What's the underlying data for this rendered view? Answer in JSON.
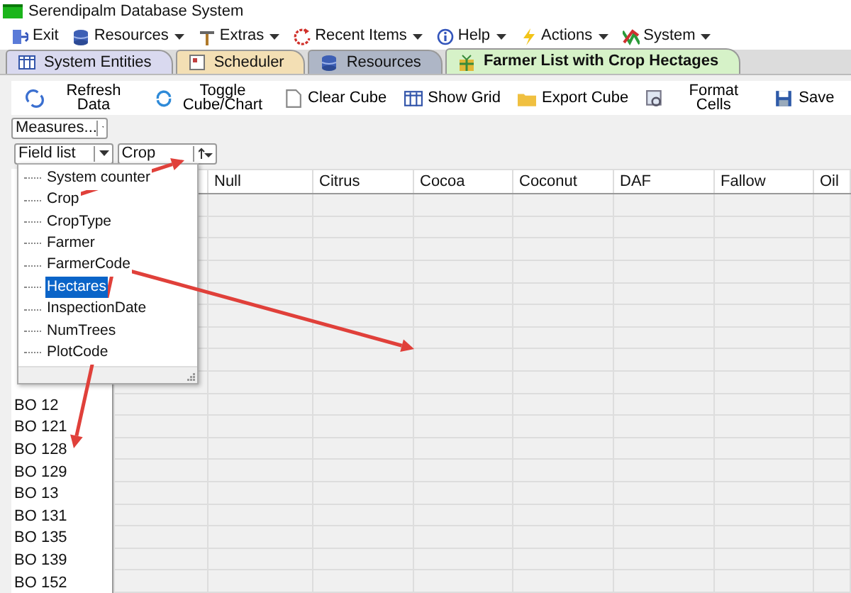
{
  "window": {
    "title": "Serendipalm Database System"
  },
  "menu": [
    {
      "label": "Exit",
      "dropdown": false
    },
    {
      "label": "Resources",
      "dropdown": true
    },
    {
      "label": "Extras",
      "dropdown": true
    },
    {
      "label": "Recent Items",
      "dropdown": true
    },
    {
      "label": "Help",
      "dropdown": true
    },
    {
      "label": "Actions",
      "dropdown": true
    },
    {
      "label": "System",
      "dropdown": true
    }
  ],
  "tabs": [
    {
      "label": "System Entities",
      "color": "#d9d9ef",
      "selected": false
    },
    {
      "label": "Scheduler",
      "color": "#f3dfb4",
      "selected": false
    },
    {
      "label": "Resources",
      "color": "#aeb6c6",
      "selected": false
    },
    {
      "label": "Farmer List with Crop Hectages",
      "color": "#d6f2c8",
      "selected": true
    }
  ],
  "toolbar": [
    {
      "label": "Refresh Data"
    },
    {
      "label": "Toggle Cube/Chart"
    },
    {
      "label": "Clear Cube"
    },
    {
      "label": "Show Grid"
    },
    {
      "label": "Export Cube"
    },
    {
      "label": "Format Cells"
    },
    {
      "label": "Save"
    }
  ],
  "measures": {
    "label": "Measures..."
  },
  "field_list": {
    "label": "Field list",
    "items": [
      {
        "label": "System counter",
        "selected": false
      },
      {
        "label": "Crop",
        "selected": false
      },
      {
        "label": "CropType",
        "selected": false
      },
      {
        "label": "Farmer",
        "selected": false
      },
      {
        "label": "FarmerCode",
        "selected": false
      },
      {
        "label": "Hectares",
        "selected": true
      },
      {
        "label": "InspectionDate",
        "selected": false
      },
      {
        "label": "NumTrees",
        "selected": false
      },
      {
        "label": "PlotCode",
        "selected": false
      }
    ]
  },
  "column_field": {
    "label": "Crop"
  },
  "grid": {
    "columns": [
      "Null",
      "Citrus",
      "Cocoa",
      "Coconut",
      "DAF",
      "Fallow",
      "Oil"
    ],
    "row_labels": [
      "BO 12",
      "BO 121",
      "BO 128",
      "BO 129",
      "BO 13",
      "BO 131",
      "BO 135",
      "BO 139",
      "BO 152"
    ]
  }
}
